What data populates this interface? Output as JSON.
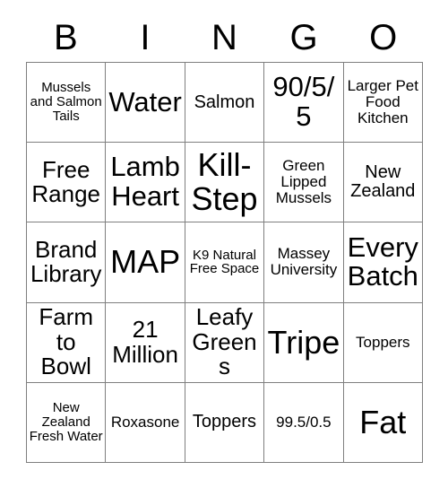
{
  "header": {
    "letters": [
      "B",
      "I",
      "N",
      "G",
      "O"
    ]
  },
  "grid": {
    "rows": [
      [
        {
          "text": "Mussels and Salmon Tails",
          "size": "fs-s"
        },
        {
          "text": "Water",
          "size": "fs-xxl"
        },
        {
          "text": "Salmon",
          "size": "fs-l"
        },
        {
          "text": "90/5/5",
          "size": "fs-xxl"
        },
        {
          "text": "Larger Pet Food Kitchen",
          "size": "fs-m"
        }
      ],
      [
        {
          "text": "Free Range",
          "size": "fs-xl"
        },
        {
          "text": "Lamb Heart",
          "size": "fs-xxl"
        },
        {
          "text": "Kill-Step",
          "size": "fs-xxxl"
        },
        {
          "text": "Green Lipped Mussels",
          "size": "fs-m"
        },
        {
          "text": "New Zealand",
          "size": "fs-l"
        }
      ],
      [
        {
          "text": "Brand Library",
          "size": "fs-xl"
        },
        {
          "text": "MAP",
          "size": "fs-xxxl"
        },
        {
          "text": "K9 Natural Free Space",
          "size": "fs-s"
        },
        {
          "text": "Massey University",
          "size": "fs-m"
        },
        {
          "text": "Every Batch",
          "size": "fs-xxl"
        }
      ],
      [
        {
          "text": "Farm to Bowl",
          "size": "fs-xl"
        },
        {
          "text": "21 Million",
          "size": "fs-xl"
        },
        {
          "text": "Leafy Greens",
          "size": "fs-xl"
        },
        {
          "text": "Tripe",
          "size": "fs-xxxl"
        },
        {
          "text": "Toppers",
          "size": "fs-m"
        }
      ],
      [
        {
          "text": "New Zealand Fresh Water",
          "size": "fs-s"
        },
        {
          "text": "Roxasone",
          "size": "fs-m"
        },
        {
          "text": "Toppers",
          "size": "fs-l"
        },
        {
          "text": "99.5/0.5",
          "size": "fs-m"
        },
        {
          "text": "Fat",
          "size": "fs-xxxl"
        }
      ]
    ]
  },
  "colors": {
    "background": "#ffffff",
    "text": "#000000",
    "grid_line": "#7f7f7f"
  }
}
